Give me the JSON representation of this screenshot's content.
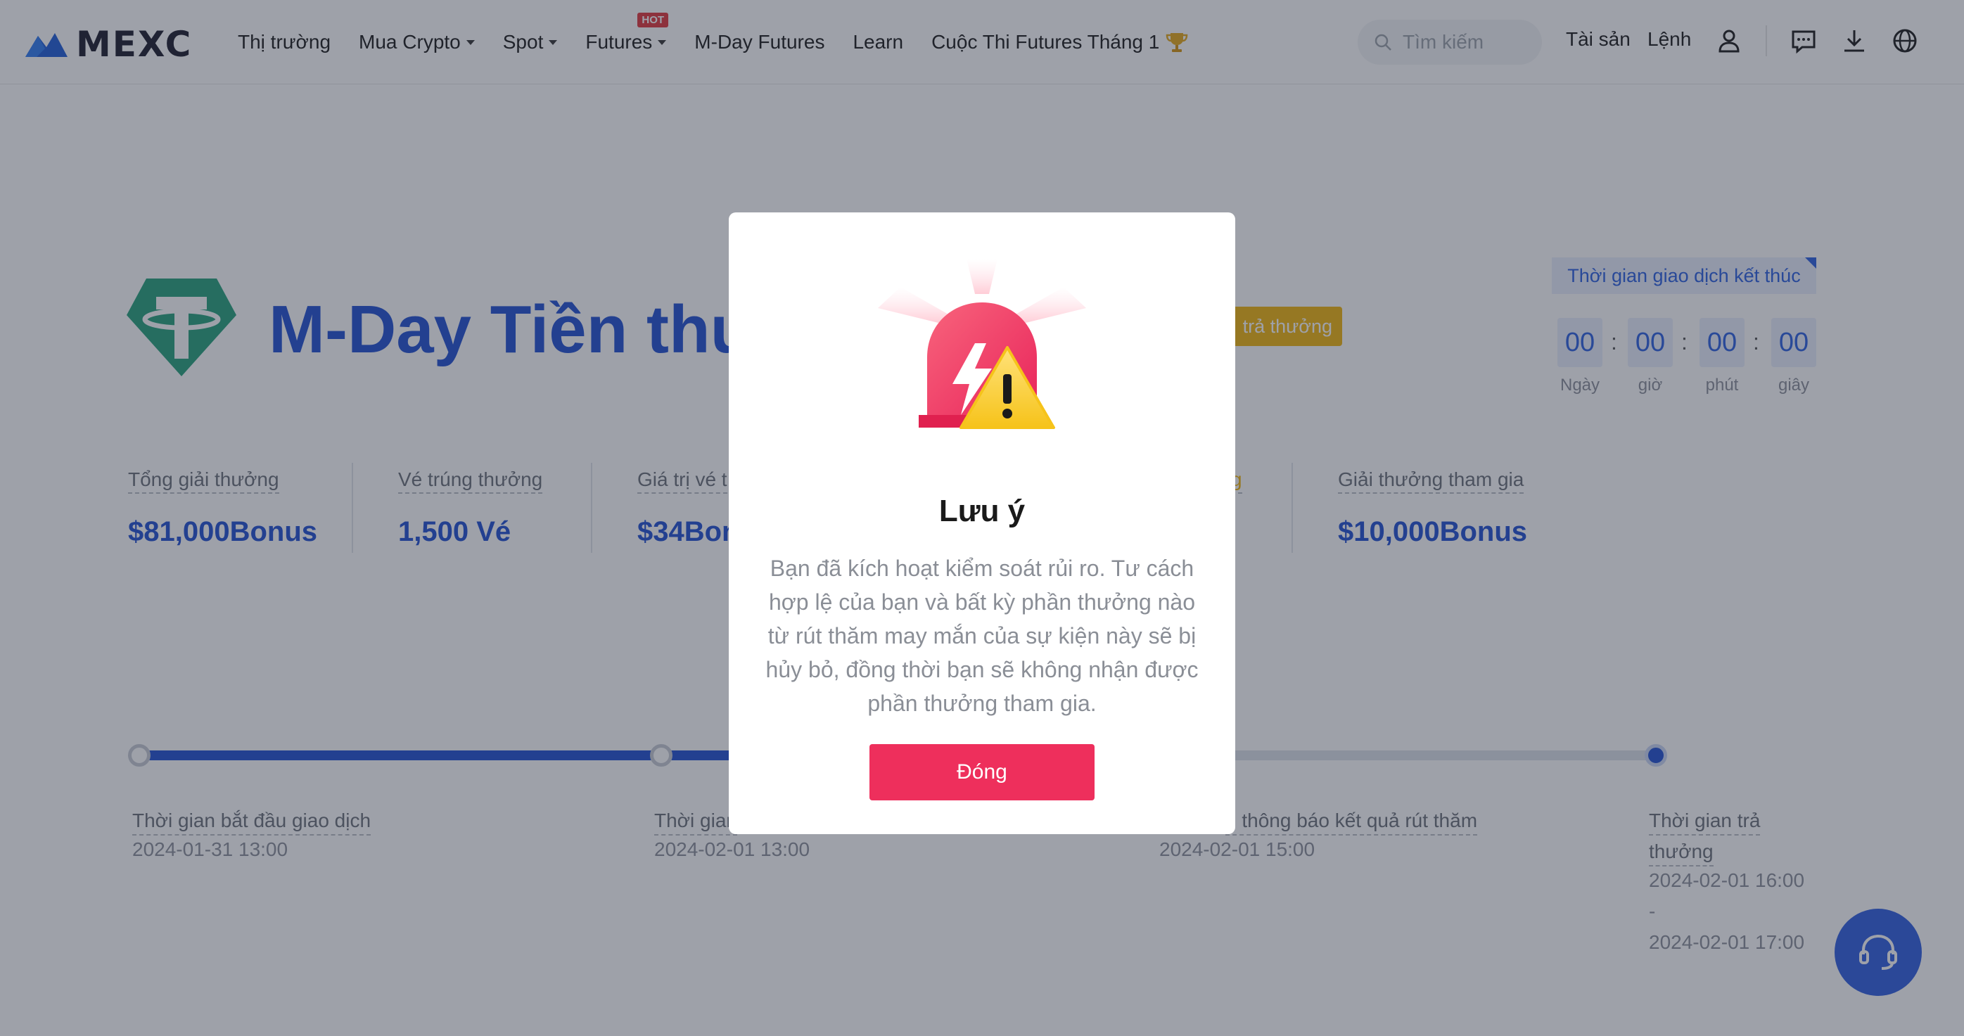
{
  "header": {
    "logo_text": "MEXC",
    "nav": [
      {
        "label": "Thị trường"
      },
      {
        "label": "Mua Crypto"
      },
      {
        "label": "Spot"
      },
      {
        "label": "Futures",
        "badge": "HOT"
      },
      {
        "label": "M-Day Futures"
      },
      {
        "label": "Learn"
      },
      {
        "label": "Cuộc Thi Futures Tháng 1"
      }
    ],
    "search_placeholder": "Tìm kiếm",
    "assets_label": "Tài sản",
    "orders_label": "Lệnh",
    "icons": [
      "user-icon",
      "chat-icon",
      "download-icon",
      "globe-icon"
    ]
  },
  "event": {
    "title": "M-Day Tiền thưởng",
    "status_tag": "trả thưởng",
    "countdown": {
      "label": "Thời gian giao dịch kết thúc",
      "days": "00",
      "hours": "00",
      "minutes": "00",
      "seconds": "00",
      "units": {
        "days": "Ngày",
        "hours": "giờ",
        "minutes": "phút",
        "seconds": "giây"
      }
    },
    "stats": [
      {
        "label": "Tổng giải thưởng",
        "value": "$81,000Bonus"
      },
      {
        "label": "Vé trúng thưởng",
        "value": "1,500 Vé"
      },
      {
        "label": "Giá trị vé t",
        "value": "$34Bon"
      },
      {
        "label": "g",
        "value": ""
      },
      {
        "label": "Giải thưởng tham gia",
        "value": "$10,000Bonus"
      }
    ],
    "timeline": [
      {
        "label": "Thời gian bắt đầu giao dịch",
        "date": "2024-01-31 13:00"
      },
      {
        "label": "Thời gian",
        "date": "2024-02-01 13:00"
      },
      {
        "label": "n thông báo kết quả rút thăm",
        "date": "2024-02-01 15:00"
      },
      {
        "label_line1": "Thời gian trả",
        "label_line2": "thưởng",
        "date_start": "2024-02-01 16:00",
        "date_sep": "-",
        "date_end": "2024-02-01 17:00"
      }
    ]
  },
  "modal": {
    "title": "Lưu ý",
    "body": "Bạn đã kích hoạt kiểm soát rủi ro. Tư cách hợp lệ của bạn và bất kỳ phần thưởng nào từ rút thăm may mắn của sự kiện này sẽ bị hủy bỏ, đồng thời bạn sẽ không nhận được phần thưởng tham gia.",
    "button_label": "Đóng"
  },
  "colors": {
    "brand_blue": "#1f4fd1",
    "modal_button": "#ee2f5c",
    "status_tag": "#f0b40c"
  }
}
